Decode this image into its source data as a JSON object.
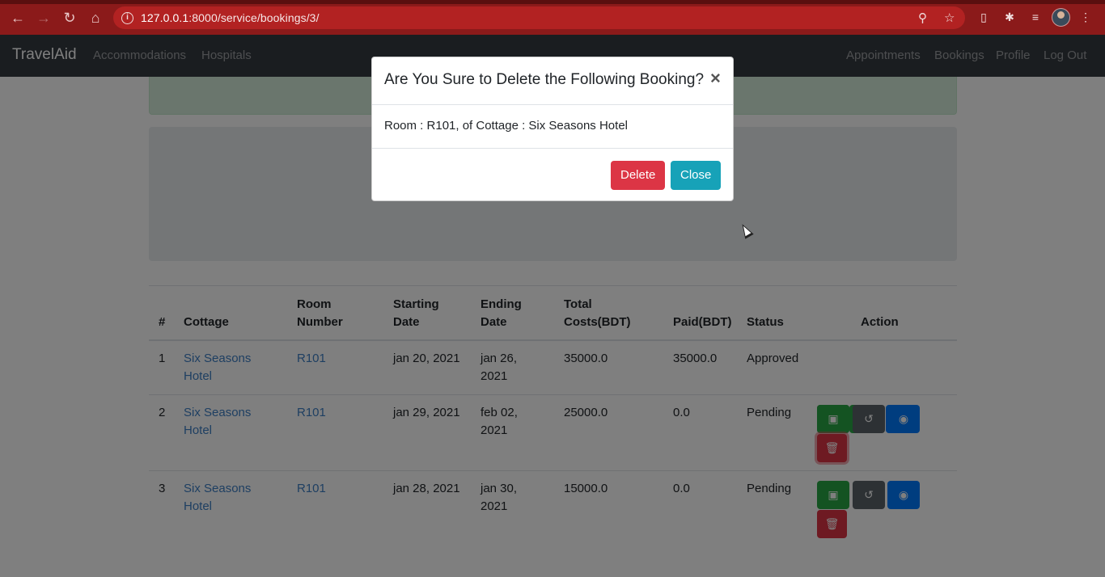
{
  "browser": {
    "url_host": "127.0.0.1",
    "url_path": ":8000/service/bookings/3/",
    "back_icon": "arrow-left-icon",
    "forward_icon": "arrow-right-icon",
    "reload_icon": "reload-icon",
    "home_icon": "home-icon"
  },
  "navbar": {
    "brand": "TravelAid",
    "left_links": [
      "Accommodations",
      "Hospitals"
    ],
    "right_links": [
      "Appointments",
      "Bookings",
      "Profile",
      "Log Out"
    ]
  },
  "table": {
    "headers": {
      "num": "#",
      "cottage": "Cottage",
      "room_number": "Room Number",
      "starting_date": "Starting Date",
      "ending_date": "Ending Date",
      "total_costs": "Total Costs(BDT)",
      "paid": "Paid(BDT)",
      "status": "Status",
      "action": "Action"
    },
    "rows": [
      {
        "num": "1",
        "cottage": "Six Seasons Hotel",
        "room": "R101",
        "start": "jan 20, 2021",
        "end": "jan 26, 2021",
        "total": "35000.0",
        "paid": "35000.0",
        "status": "Approved"
      },
      {
        "num": "2",
        "cottage": "Six Seasons Hotel",
        "room": "R101",
        "start": "jan 29, 2021",
        "end": "feb 02, 2021",
        "total": "25000.0",
        "paid": "0.0",
        "status": "Pending"
      },
      {
        "num": "3",
        "cottage": "Six Seasons Hotel",
        "room": "R101",
        "start": "jan 28, 2021",
        "end": "jan 30, 2021",
        "total": "15000.0",
        "paid": "0.0",
        "status": "Pending"
      }
    ]
  },
  "modal": {
    "title": "Are You Sure to Delete the Following Booking?",
    "close_glyph": "×",
    "body": "Room : R101, of Cottage : Six Seasons Hotel",
    "delete_label": "Delete",
    "close_label": "Close"
  },
  "colors": {
    "danger": "#dc3545",
    "info": "#17a2b8",
    "success": "#28a745",
    "primary": "#007bff",
    "secondary": "#5a6268"
  }
}
